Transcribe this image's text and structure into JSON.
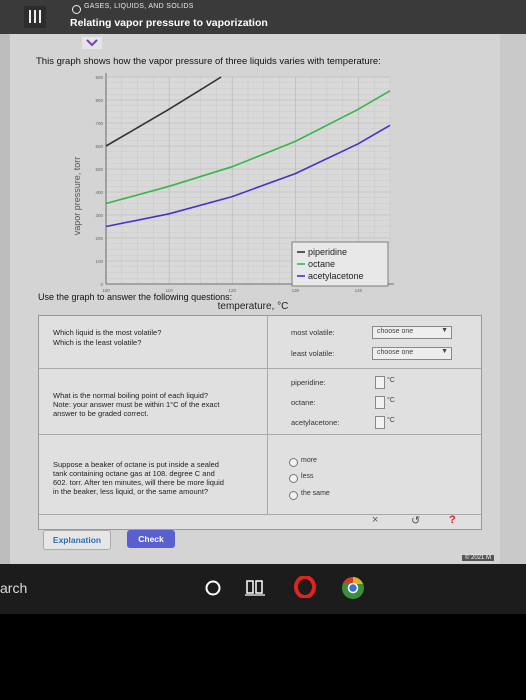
{
  "header": {
    "category": "GASES, LIQUIDS, AND SOLIDS",
    "topic": "Relating vapor pressure to vaporization",
    "menu_icon": "menu-icon"
  },
  "intro": "This graph shows how the vapor pressure of three liquids varies with temperature:",
  "chart_data": {
    "type": "line",
    "xlabel": "temperature, °C",
    "ylabel": "vapor pressure, torr",
    "xlim": [
      100,
      145
    ],
    "ylim": [
      0,
      900
    ],
    "x_ticks": [
      "100",
      "110",
      "120",
      "130",
      "140"
    ],
    "y_ticks": [
      "0",
      "100",
      "200",
      "300",
      "400",
      "500",
      "600",
      "700",
      "800",
      "900"
    ],
    "legend_placement": "bottom-right",
    "series": [
      {
        "name": "piperidine",
        "color": "#333333",
        "x": [
          100,
          105,
          110,
          115,
          120
        ],
        "y": [
          600,
          680,
          760,
          845,
          930
        ]
      },
      {
        "name": "octane",
        "color": "#39b54a",
        "x": [
          100,
          110,
          120,
          130,
          140,
          145
        ],
        "y": [
          350,
          425,
          510,
          620,
          760,
          840
        ]
      },
      {
        "name": "acetylacetone",
        "color": "#4433cc",
        "x": [
          100,
          110,
          120,
          130,
          140,
          145
        ],
        "y": [
          250,
          305,
          380,
          480,
          610,
          690
        ]
      }
    ]
  },
  "use_text": "Use the graph to answer the following questions:",
  "q1": {
    "text1": "Which liquid is the most volatile?",
    "text2": "Which is the least volatile?",
    "most_label": "most volatile:",
    "least_label": "least volatile:",
    "select1": "choose one",
    "select2": "choose one"
  },
  "q2": {
    "text1": "What is the normal boiling point of each liquid?",
    "text2": "Note: your answer must be within 1°C of the exact",
    "text3": "answer to be graded correct.",
    "label1": "piperidine:",
    "label2": "octane:",
    "label3": "acetylacetone:",
    "unit": "°C"
  },
  "q3": {
    "text1": "Suppose a beaker of octane is put inside a sealed",
    "text2": "tank containing octane gas at 108. degree C and",
    "text3": "602. torr. After ten minutes, will there be more liquid",
    "text4": "in the beaker, less liquid, or the same amount?",
    "opt1": "more",
    "opt2": "less",
    "opt3": "the same"
  },
  "actions": {
    "close": "×",
    "undo": "↺",
    "help": "?"
  },
  "buttons": {
    "explanation": "Explanation",
    "check": "Check"
  },
  "copyright": "© 2021 M",
  "taskbar": {
    "search": "arch"
  }
}
